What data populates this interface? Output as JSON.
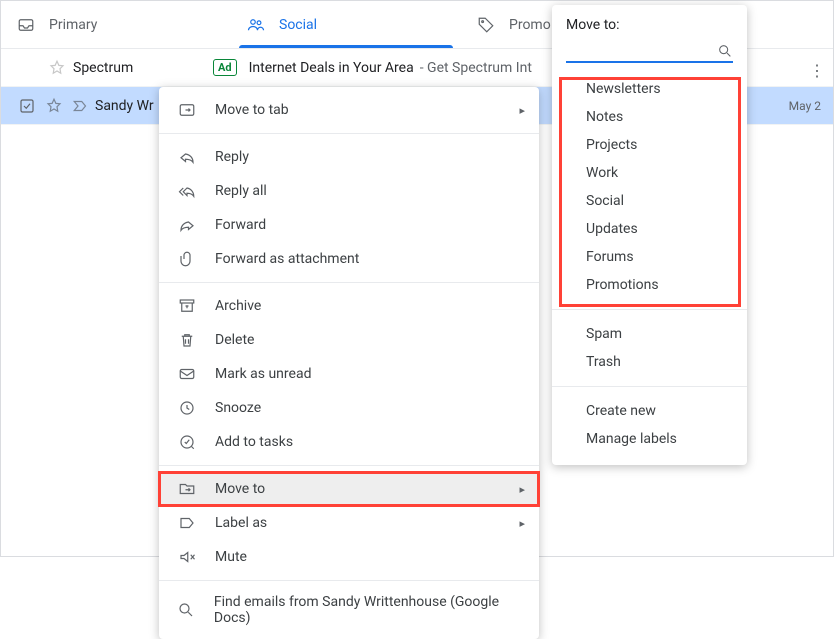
{
  "tabs": {
    "primary": "Primary",
    "social": "Social",
    "promotions": "Promo"
  },
  "rows": {
    "ad": {
      "sender": "Spectrum",
      "badge": "Ad",
      "subject": "Internet Deals in Your Area",
      "snippet": " - Get Spectrum Int"
    },
    "selected": {
      "sender": "Sandy Wr",
      "date": "May 2"
    }
  },
  "context_menu": {
    "move_to_tab": "Move to tab",
    "reply": "Reply",
    "reply_all": "Reply all",
    "forward": "Forward",
    "forward_attachment": "Forward as attachment",
    "archive": "Archive",
    "delete": "Delete",
    "mark_unread": "Mark as unread",
    "snooze": "Snooze",
    "add_tasks": "Add to tasks",
    "move_to": "Move to",
    "label_as": "Label as",
    "mute": "Mute",
    "find_emails": "Find emails from Sandy Writtenhouse (Google Docs)"
  },
  "moveto": {
    "title": "Move to:",
    "labels": [
      "Newsletters",
      "Notes",
      "Projects",
      "Work",
      "Social",
      "Updates",
      "Forums",
      "Promotions"
    ],
    "spam": "Spam",
    "trash": "Trash",
    "create_new": "Create new",
    "manage_labels": "Manage labels"
  }
}
